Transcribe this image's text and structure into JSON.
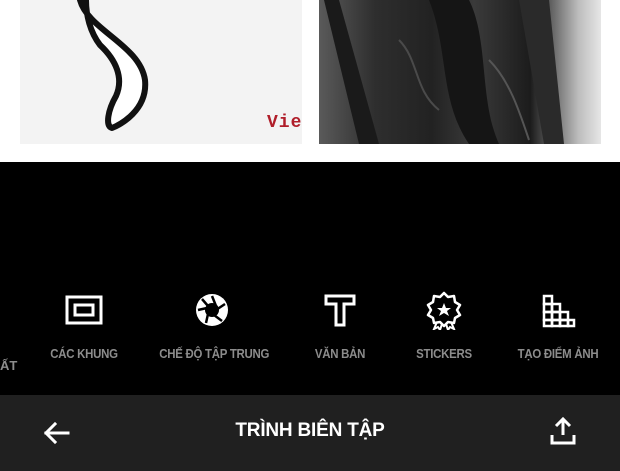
{
  "preview": {
    "left_watermark": "Vietl"
  },
  "tools": {
    "partial_label": "ẤT",
    "items": [
      {
        "label": "CÁC KHUNG",
        "icon": "frame-icon"
      },
      {
        "label": "CHẾ ĐỘ TẬP TRUNG",
        "icon": "aperture-focus-icon"
      },
      {
        "label": "VĂN BẢN",
        "icon": "text-icon"
      },
      {
        "label": "STICKERS",
        "icon": "sticker-badge-icon"
      },
      {
        "label": "TẠO ĐIỂM ẢNH",
        "icon": "pixelate-icon"
      }
    ]
  },
  "bottom_bar": {
    "title": "TRÌNH BIÊN TẬP",
    "back_icon": "back-arrow-icon",
    "share_icon": "upload-share-icon"
  },
  "colors": {
    "background": "#000000",
    "bottom_bar": "#202020",
    "label_gray": "#8c8c8c",
    "icon_white": "#ffffff",
    "watermark_red": "#b01e2a"
  }
}
